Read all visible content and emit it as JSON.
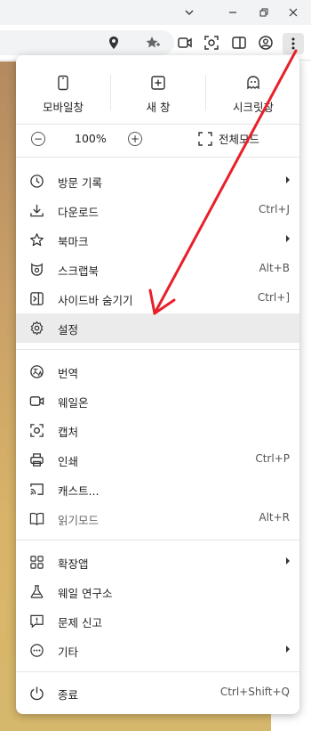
{
  "menu": {
    "top": [
      {
        "label": "모바일창",
        "icon": "mobile-window-icon"
      },
      {
        "label": "새 창",
        "icon": "new-window-icon"
      },
      {
        "label": "시크릿창",
        "icon": "secret-window-icon"
      }
    ],
    "zoom": {
      "value": "100%",
      "minus": "−",
      "plus": "+",
      "fullscreen_label": "전체모드"
    },
    "items": [
      {
        "label": "방문 기록",
        "shortcut": ""
      },
      {
        "label": "다운로드",
        "shortcut": "Ctrl+J"
      },
      {
        "label": "북마크",
        "shortcut": ""
      },
      {
        "label": "스크랩북",
        "shortcut": "Alt+B"
      },
      {
        "label": "사이드바 숨기기",
        "shortcut": "Ctrl+]"
      },
      {
        "label": "설정",
        "shortcut": ""
      },
      {
        "label": "번역",
        "shortcut": ""
      },
      {
        "label": "웨일온",
        "shortcut": ""
      },
      {
        "label": "캡처",
        "shortcut": ""
      },
      {
        "label": "인쇄",
        "shortcut": "Ctrl+P"
      },
      {
        "label": "캐스트...",
        "shortcut": ""
      },
      {
        "label": "읽기모드",
        "shortcut": "Alt+R"
      },
      {
        "label": "확장앱",
        "shortcut": ""
      },
      {
        "label": "웨일 연구소",
        "shortcut": ""
      },
      {
        "label": "문제 신고",
        "shortcut": ""
      },
      {
        "label": "기타",
        "shortcut": ""
      },
      {
        "label": "종료",
        "shortcut": "Ctrl+Shift+Q"
      }
    ]
  },
  "annotation": {
    "color": "#e8202a"
  },
  "colors": {
    "highlight": "#ebebeb",
    "accent": "#e8202a"
  }
}
